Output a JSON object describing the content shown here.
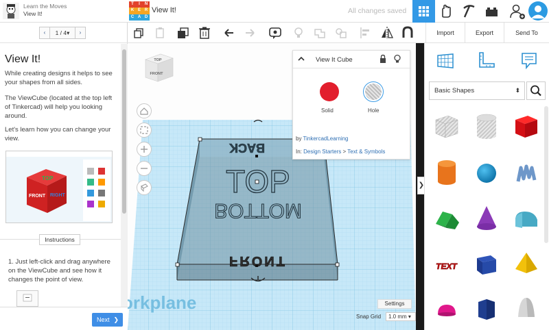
{
  "lesson": {
    "course": "Learn the Moves",
    "name": "View It!",
    "pager": {
      "prev": "‹",
      "count": "1 / 4▾",
      "next": "›"
    },
    "title": "View It!",
    "paragraphs": [
      "While creating designs it helps to see your shapes from all sides.",
      "The ViewCube (located at the top left of Tinkercad) will help you looking around.",
      "Let's learn how you can change your view."
    ],
    "instructions_tab": "Instructions",
    "steps": [
      "1.  Just left-click and drag anywhere on the ViewCube and see how it changes the point of view."
    ],
    "next_button": "Next",
    "image_labels": {
      "top": "TOP",
      "front": "FRONT",
      "right": "RIGHT"
    }
  },
  "topbar": {
    "logo_letters": [
      "T",
      "I",
      "N",
      "K",
      "E",
      "R",
      "C",
      "A",
      "D"
    ],
    "logo_colors": [
      "#e2412b",
      "#e2412b",
      "#e2412b",
      "#f5a623",
      "#f5a623",
      "#f5a623",
      "#2fa6de",
      "#2fa6de",
      "#2fa6de"
    ],
    "design_name": "View It!",
    "save_status": "All changes saved",
    "icons": [
      "grid-view-icon",
      "hand-tinker-icon",
      "pickaxe-icon",
      "bricks-icon",
      "add-user-icon",
      "avatar"
    ]
  },
  "toolbar": {
    "icons": [
      "copy-icon",
      "paste-icon",
      "duplicate-icon",
      "delete-icon",
      "undo-icon",
      "redo-icon",
      "comment-icon",
      "light-icon",
      "group-icon",
      "ungroup-icon",
      "align-icon",
      "mirror-icon",
      "magnet-icon"
    ],
    "import": "Import",
    "export": "Export",
    "send_to": "Send To"
  },
  "viewport": {
    "viewcube": {
      "top": "TOP",
      "front": "FRONT"
    },
    "model_texts": {
      "top": "TOP",
      "bottom": "BOTTOM",
      "front": "FRONT",
      "back": "BACK"
    },
    "workplane_label": "orkplane",
    "settings": "Settings",
    "snap_grid_label": "Snap Grid",
    "snap_grid_value": "1.0 mm ▾",
    "collapse": "❯"
  },
  "inspector": {
    "title": "View It Cube",
    "solid": "Solid",
    "hole": "Hole",
    "by_prefix": "by",
    "author": "TinkercadLearning",
    "in_prefix": "In:",
    "crumb_1": "Design Starters",
    "crumb_sep": ">",
    "crumb_2": "Text & Symbols",
    "solid_color": "#e21e2d"
  },
  "shapes": {
    "category_icons": [
      "workplane-icon",
      "ruler-icon",
      "note-icon"
    ],
    "selected_library": "Basic Shapes",
    "items": [
      "box-hole",
      "cylinder-hole",
      "box",
      "cylinder",
      "sphere",
      "scribble",
      "roof",
      "cone",
      "round-roof",
      "text",
      "wedge",
      "pyramid",
      "half-sphere",
      "polygon",
      "paraboloid"
    ],
    "text_shape_label": "TEXT"
  },
  "colors": {
    "accent": "#3399e6",
    "workplane": "#bfe3f7",
    "grid": "#8ccbe8"
  }
}
